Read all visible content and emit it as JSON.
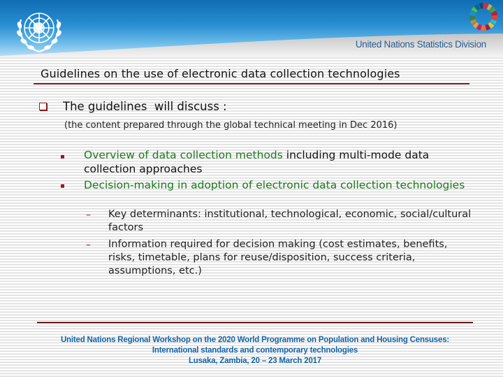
{
  "header": {
    "emblem": "un-emblem-icon",
    "sdg_logo": "sdg-wheel-icon",
    "division_name": "United Nations Statistics Division",
    "sdg_colors": [
      "#e5243b",
      "#dda63a",
      "#4c9f38",
      "#c5192d",
      "#ff3a21",
      "#26bde2",
      "#fcc30b",
      "#a21942",
      "#fd6925",
      "#dd1367",
      "#fd9d24",
      "#bf8b2e",
      "#3f7e44",
      "#0a97d9",
      "#56c02b",
      "#00689d",
      "#19486a"
    ]
  },
  "slide": {
    "title": "Guidelines on the use of electronic data collection technologies",
    "lead": "The guidelines  will discuss :",
    "note": "(the content prepared through the global technical meeting in Dec 2016)",
    "items": [
      {
        "highlight": "Overview of data collection methods",
        "rest": " including multi-mode data collection approaches"
      },
      {
        "highlight": "Decision-making in adoption of electronic data collection technologies",
        "rest": ""
      }
    ],
    "sub_items": [
      "Key determinants: institutional, technological, economic, social/cultural factors",
      "Information required for decision making (cost estimates, benefits, risks, timetable, plans for reuse/disposition, success criteria, assumptions, etc.)"
    ],
    "dash_glyph": "–"
  },
  "footer": {
    "line1": "United Nations Regional Workshop on the 2020 World Programme on Population and Housing Censuses:",
    "line2": "International standards and contemporary technologies",
    "line3": "Lusaka, Zambia, 20 – 23 March 2017"
  },
  "colors": {
    "accent_red": "#a01818",
    "highlight_green": "#1d7a1d",
    "footer_blue": "#1565a8",
    "division_blue": "#2b5e93"
  }
}
